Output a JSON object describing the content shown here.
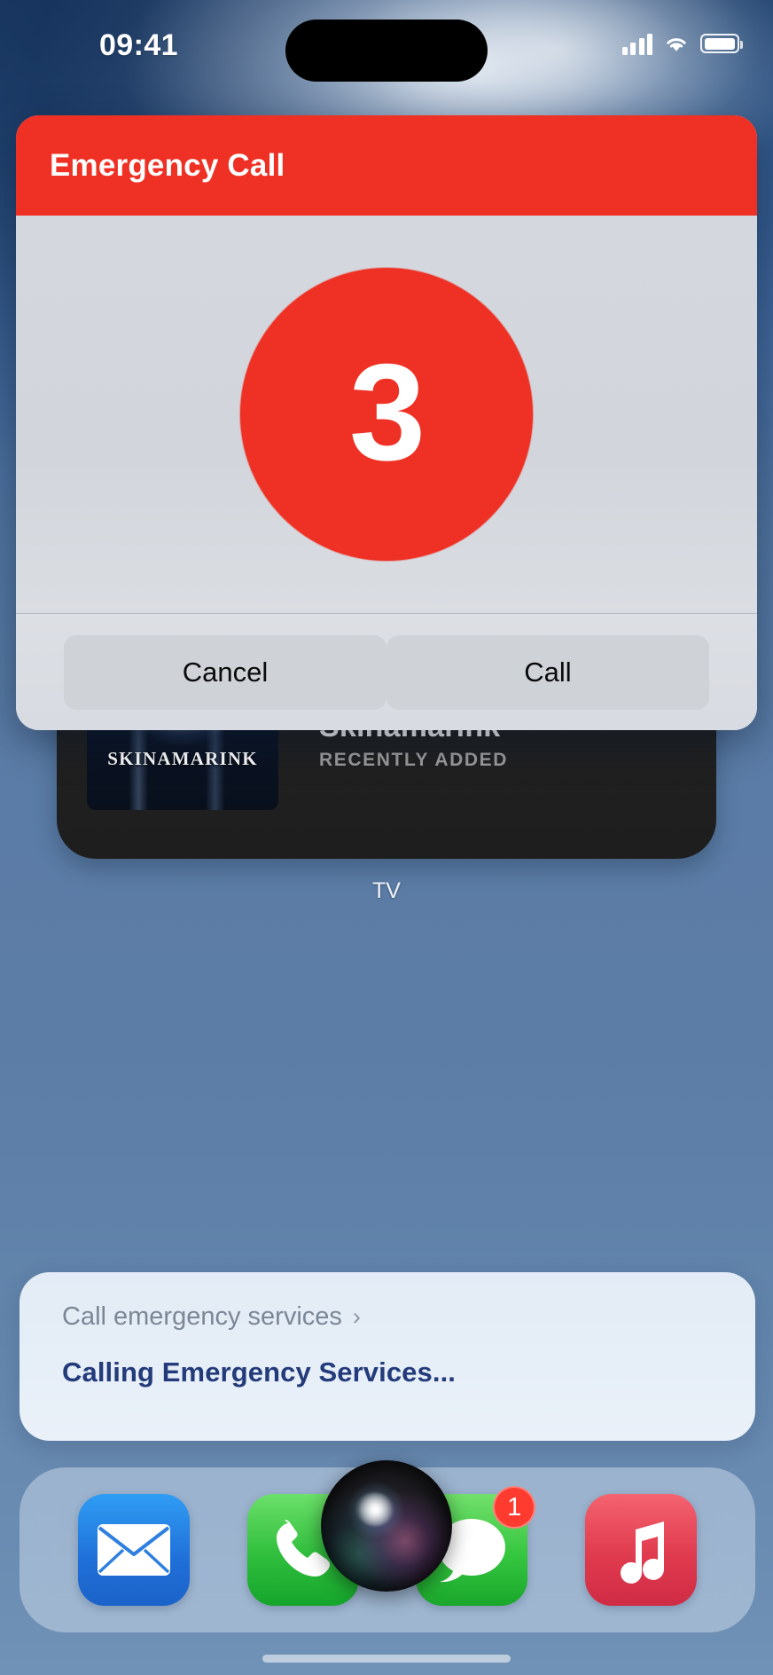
{
  "status_bar": {
    "time": "09:41",
    "icons": [
      "cellular-signal-icon",
      "wifi-icon",
      "battery-icon"
    ]
  },
  "dialog": {
    "title": "Emergency Call",
    "countdown": "3",
    "cancel_label": "Cancel",
    "call_label": "Call",
    "accent_color": "#EE3124"
  },
  "tv_widget": {
    "poster_text": "SKINAMARINK",
    "title": "Skinamarink",
    "subtitle": "RECENTLY ADDED",
    "app_label": "TV"
  },
  "siri_card": {
    "query": "Call emergency services",
    "chevron": "›",
    "answer": "Calling Emergency Services..."
  },
  "dock": {
    "apps": [
      {
        "name": "Mail",
        "icon": "mail-icon",
        "badge": ""
      },
      {
        "name": "Phone",
        "icon": "phone-icon",
        "badge": ""
      },
      {
        "name": "Messages",
        "icon": "messages-icon",
        "badge": "1"
      },
      {
        "name": "Music",
        "icon": "music-note-icon",
        "badge": ""
      }
    ],
    "siri_orb": "siri-orb-icon"
  }
}
